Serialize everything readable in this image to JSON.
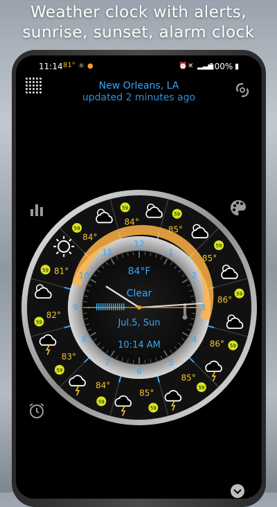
{
  "promo": {
    "line1": "Weather clock with alerts,",
    "line2": "sunrise, sunset, alarm clock"
  },
  "status_bar": {
    "time": "11:14",
    "temp": "81°",
    "battery": "100%"
  },
  "header": {
    "location": "New Orleans, LA",
    "updated": "updated 2 minutes ago"
  },
  "clock": {
    "temperature": "84°F",
    "condition": "Clear",
    "date": "Jul.5, Sun",
    "time": "10:14 AM",
    "hour_numbers": [
      "12",
      "1",
      "2",
      "3",
      "4",
      "5",
      "6",
      "7",
      "8",
      "9",
      "10",
      "11"
    ],
    "forecast": [
      {
        "temp": "85°",
        "icon": "partly-cloudy-icon",
        "air": "59"
      },
      {
        "temp": "85°",
        "icon": "partly-cloudy-icon",
        "air": "59"
      },
      {
        "temp": "86°",
        "icon": "partly-cloudy-icon",
        "air": "59"
      },
      {
        "temp": "86°",
        "icon": "partly-cloudy-icon",
        "air": "59"
      },
      {
        "temp": "85°",
        "icon": "thunderstorm-icon",
        "air": "59"
      },
      {
        "temp": "85°",
        "icon": "thunderstorm-icon",
        "air": "59"
      },
      {
        "temp": "84°",
        "icon": "thunderstorm-icon",
        "air": "59"
      },
      {
        "temp": "83°",
        "icon": "thunderstorm-icon",
        "air": "59"
      },
      {
        "temp": "82°",
        "icon": "thunderstorm-icon",
        "air": "59"
      },
      {
        "temp": "81°",
        "icon": "partly-cloudy-icon",
        "air": "59"
      },
      {
        "temp": "84°",
        "icon": "sunny-icon",
        "air": "59"
      },
      {
        "temp": "84°",
        "icon": "partly-cloudy-icon",
        "air": "59"
      }
    ],
    "colors": {
      "accent_blue": "#35a8ff",
      "forecast_temp": "#f4c430",
      "air_badge": "#d8e51c",
      "sun_arc": "#ffb347",
      "second_hand": "#f4a020"
    }
  },
  "side_icons": {
    "left_top": "grid-menu-icon",
    "left_mid": "bar-chart-icon",
    "left_bottom": "alarm-clock-icon",
    "right_top": "hurricane-icon",
    "right_mid": "palette-icon",
    "bottom": "chevron-down-icon"
  }
}
